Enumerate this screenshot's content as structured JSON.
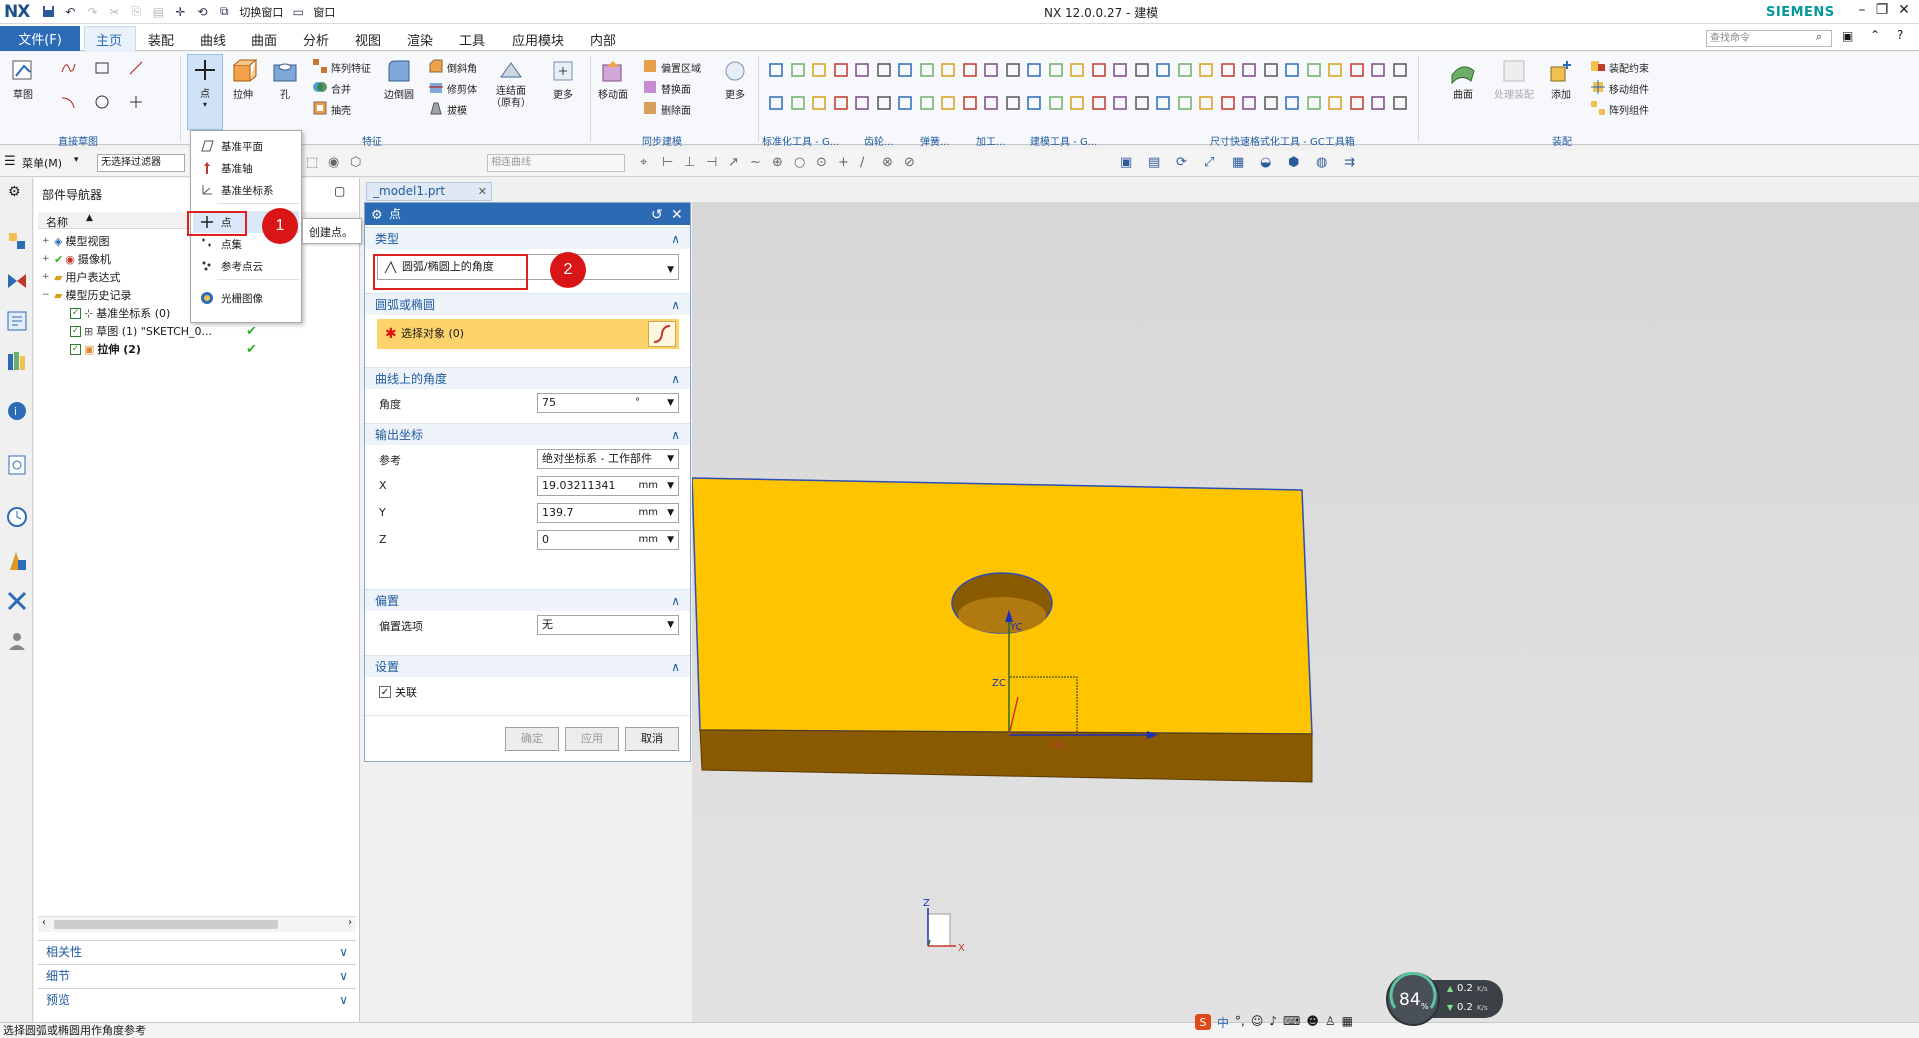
{
  "titlebar": {
    "logo": "NX",
    "switch_window": "切换窗口",
    "window_menu": "窗口",
    "title": "NX 12.0.0.27 - 建模",
    "brand": "SIEMENS"
  },
  "menubar": {
    "file": "文件(F)",
    "tabs": [
      "主页",
      "装配",
      "曲线",
      "曲面",
      "分析",
      "视图",
      "渲染",
      "工具",
      "应用模块",
      "内部"
    ],
    "search_placeholder": "查找命令"
  },
  "ribbon": {
    "sketch": "草图",
    "point": "点",
    "extrude": "拉伸",
    "hole": "孔",
    "array_feature": "阵列特征",
    "combine": "合并",
    "shell": "抽壳",
    "edge_blend": "边倒圆",
    "chamfer": "倒斜角",
    "trim_body": "修剪体",
    "draft": "拔模",
    "loft": "连结面（原有）",
    "more1": "更多",
    "move_face": "移动面",
    "offset_region": "偏置区域",
    "replace_face": "替换面",
    "delete_face": "删除面",
    "more2": "更多",
    "surface": "曲面",
    "process_feature": "处理装配",
    "add": "添加",
    "assembly_constraint": "装配约束",
    "move_component": "移动组件",
    "array_component": "阵列组件",
    "groups": [
      "直接草图",
      "特征",
      "同步建模",
      "标准化工具 - G...",
      "齿轮...",
      "弹簧...",
      "加工...",
      "建模工具 - G...",
      "尺寸快速格式化工具 - GC工具箱",
      "装配"
    ]
  },
  "toolbar2": {
    "menu": "菜单(M)",
    "filter": "无选择过滤器",
    "curve_rule": "相连曲线"
  },
  "navigator": {
    "title": "部件导航器",
    "column": "名称",
    "items": [
      {
        "label": "模型视图",
        "level": 0
      },
      {
        "label": "摄像机",
        "level": 0
      },
      {
        "label": "用户表达式",
        "level": 0
      },
      {
        "label": "模型历史记录",
        "level": 0
      },
      {
        "label": "基准坐标系 (0)",
        "level": 1
      },
      {
        "label": "草图 (1) \"SKETCH_0...",
        "level": 1
      },
      {
        "label": "拉伸 (2)",
        "level": 1
      }
    ],
    "sections": [
      "相关性",
      "细节",
      "预览"
    ]
  },
  "dropdown": {
    "items": [
      "基准平面",
      "基准轴",
      "基准坐标系",
      "点",
      "点集",
      "参考点云",
      "光栅图像"
    ],
    "tooltip": "创建点。"
  },
  "annotations": {
    "badge1": "1",
    "badge2": "2"
  },
  "doc_tab": "_model1.prt",
  "dialog": {
    "title": "点",
    "type_section": "类型",
    "type_value": "圆弧/椭圆上的角度",
    "arc_section": "圆弧或椭圆",
    "select_object": "选择对象 (0)",
    "angle_section": "曲线上的角度",
    "angle_label": "角度",
    "angle_value": "75",
    "angle_unit": "°",
    "output_section": "输出坐标",
    "ref_label": "参考",
    "ref_value": "绝对坐标系 - 工作部件",
    "x_label": "X",
    "x_value": "19.03211341",
    "y_label": "Y",
    "y_value": "139.7",
    "z_label": "Z",
    "z_value": "0",
    "unit": "mm",
    "offset_section": "偏置",
    "offset_label": "偏置选项",
    "offset_value": "无",
    "settings_section": "设置",
    "associative": "关联",
    "ok": "确定",
    "apply": "应用",
    "cancel": "取消"
  },
  "viewport": {
    "yc": "YC",
    "zc": "ZC",
    "xc": "XC",
    "x": "X",
    "z": "Z"
  },
  "status": {
    "message": "选择圆弧或椭圆用作角度参考",
    "speed_percent": "84",
    "up": "0.2",
    "down": "0.2",
    "speed_unit": "K/s",
    "ime": "中"
  },
  "colors": {
    "accent": "#2c6bb6",
    "part_top": "#ffc400",
    "part_side": "#8a5a00",
    "annotation": "#e02020"
  }
}
